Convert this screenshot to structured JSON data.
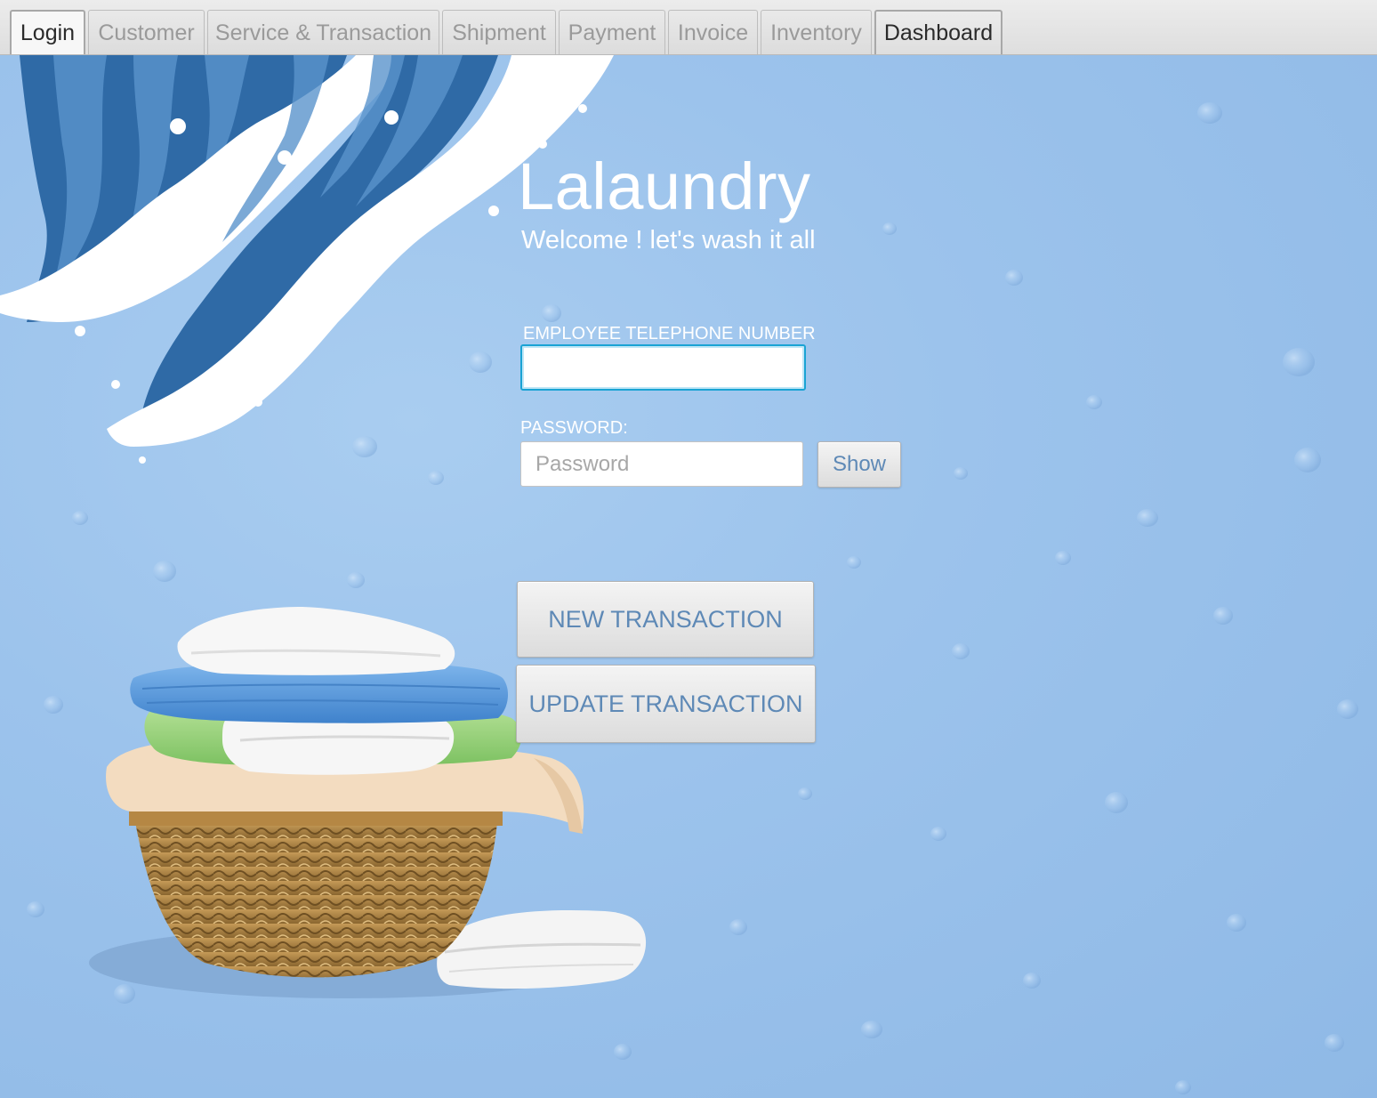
{
  "tabs": [
    {
      "label": "Login",
      "state": "active"
    },
    {
      "label": "Customer",
      "state": "inactive"
    },
    {
      "label": "Service & Transaction",
      "state": "inactive"
    },
    {
      "label": "Shipment",
      "state": "inactive"
    },
    {
      "label": "Payment",
      "state": "inactive"
    },
    {
      "label": "Invoice",
      "state": "inactive"
    },
    {
      "label": "Inventory",
      "state": "inactive"
    },
    {
      "label": "Dashboard",
      "state": "highlighted"
    }
  ],
  "login": {
    "title": "Lalaundry",
    "subtitle": "Welcome ! let's wash it all",
    "phone_label": "EMPLOYEE TELEPHONE NUMBER",
    "phone_value": "",
    "password_label": "PASSWORD:",
    "password_placeholder": "Password",
    "password_value": "",
    "show_label": "Show",
    "new_transaction_label": "NEW TRANSACTION",
    "update_transaction_label": "UPDATE TRANSACTION"
  },
  "colors": {
    "background": "#9cc3ec",
    "button_text": "#5e89b6",
    "focus_border": "#1aa3d4",
    "wave_dark": "#2f6aa6",
    "wave_light": "#ffffff"
  },
  "icons": {
    "wave": "wave-illustration",
    "basket": "laundry-basket-illustration"
  }
}
